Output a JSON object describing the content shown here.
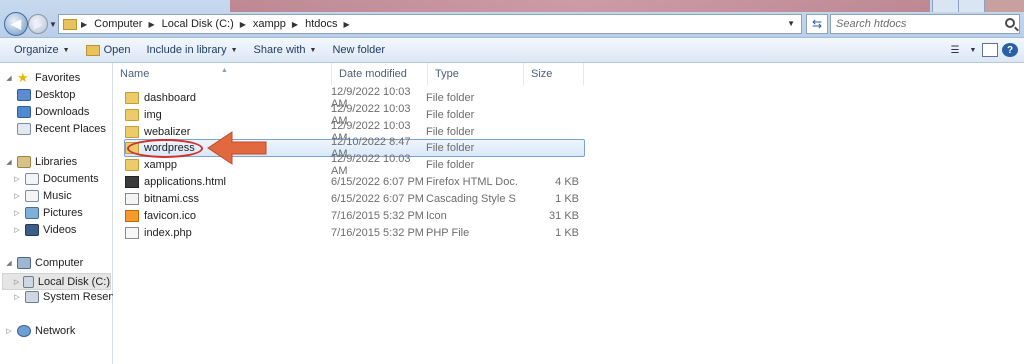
{
  "address": {
    "crumbs": [
      "Computer",
      "Local Disk (C:)",
      "xampp",
      "htdocs"
    ]
  },
  "search": {
    "placeholder": "Search htdocs"
  },
  "toolbar": {
    "organize": "Organize",
    "open": "Open",
    "include_in_library": "Include in library",
    "share_with": "Share with",
    "new_folder": "New folder"
  },
  "nav": {
    "favorites": "Favorites",
    "desktop": "Desktop",
    "downloads": "Downloads",
    "recent_places": "Recent Places",
    "libraries": "Libraries",
    "documents": "Documents",
    "music": "Music",
    "pictures": "Pictures",
    "videos": "Videos",
    "computer": "Computer",
    "local_disk": "Local Disk (C:)",
    "system_reserved": "System Reserved",
    "network": "Network"
  },
  "columns": {
    "name": "Name",
    "date": "Date modified",
    "type": "Type",
    "size": "Size"
  },
  "files": [
    {
      "name": "dashboard",
      "date": "12/9/2022 10:03 AM",
      "type": "File folder",
      "size": "",
      "icon": "folder-icon"
    },
    {
      "name": "img",
      "date": "12/9/2022 10:03 AM",
      "type": "File folder",
      "size": "",
      "icon": "folder-icon"
    },
    {
      "name": "webalizer",
      "date": "12/9/2022 10:03 AM",
      "type": "File folder",
      "size": "",
      "icon": "folder-icon"
    },
    {
      "name": "wordpress",
      "date": "12/10/2022 8:47 AM",
      "type": "File folder",
      "size": "",
      "icon": "folder-icon"
    },
    {
      "name": "xampp",
      "date": "12/9/2022 10:03 AM",
      "type": "File folder",
      "size": "",
      "icon": "folder-icon"
    },
    {
      "name": "applications.html",
      "date": "6/15/2022 6:07 PM",
      "type": "Firefox HTML Doc...",
      "size": "4 KB",
      "icon": "html-file-icon"
    },
    {
      "name": "bitnami.css",
      "date": "6/15/2022 6:07 PM",
      "type": "Cascading Style S...",
      "size": "1 KB",
      "icon": "css-file-icon"
    },
    {
      "name": "favicon.ico",
      "date": "7/16/2015 5:32 PM",
      "type": "Icon",
      "size": "31 KB",
      "icon": "ico-file-icon"
    },
    {
      "name": "index.php",
      "date": "7/16/2015 5:32 PM",
      "type": "PHP File",
      "size": "1 KB",
      "icon": "php-file-icon"
    }
  ],
  "selected_file": "wordpress",
  "colors": {
    "annotation": "#d1302c",
    "arrow": "#e0693f",
    "selection_border": "#7da2ce"
  }
}
